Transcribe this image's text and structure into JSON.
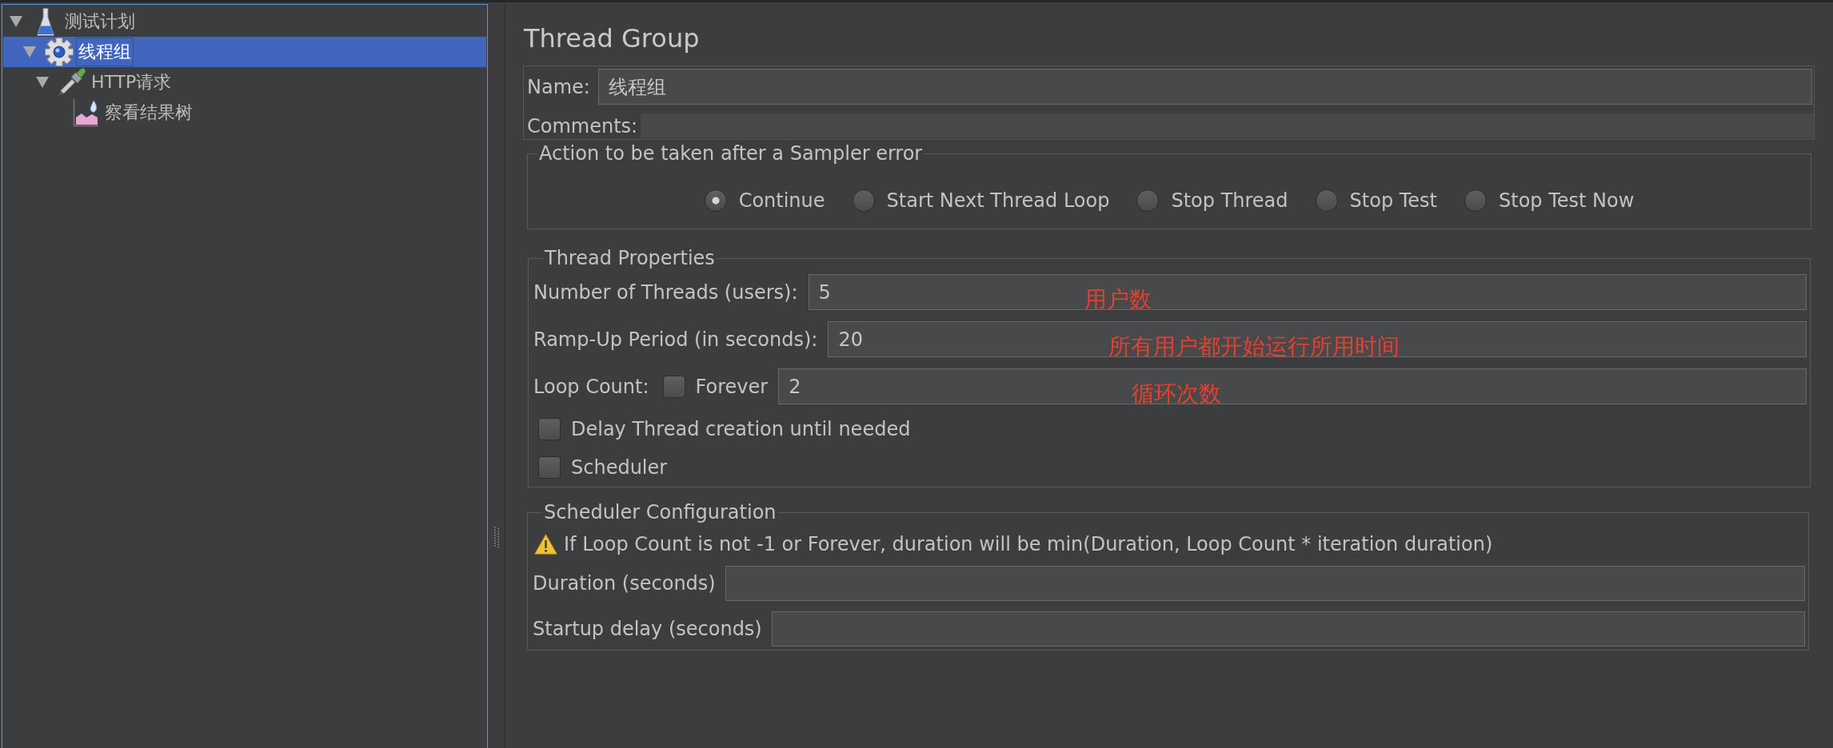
{
  "tree": [
    {
      "label": "测试计划",
      "kind": "test-plan",
      "expanded": true,
      "selected": false,
      "children": [
        {
          "label": "线程组",
          "kind": "thread-group",
          "expanded": true,
          "selected": true,
          "children": [
            {
              "label": "HTTP请求",
              "kind": "sampler",
              "expanded": true,
              "selected": false,
              "children": [
                {
                  "label": "察看结果树",
                  "kind": "listener",
                  "selected": false
                }
              ]
            }
          ]
        }
      ]
    }
  ],
  "editor": {
    "title": "Thread Group",
    "name_field": {
      "label": "Name:",
      "value": "线程组"
    },
    "comments_field": {
      "label": "Comments:"
    },
    "sampler_error": {
      "title": "Action to be taken after a Sampler error",
      "options": [
        {
          "label": "Continue",
          "selected": true
        },
        {
          "label": "Start Next Thread Loop",
          "selected": false
        },
        {
          "label": "Stop Thread",
          "selected": false
        },
        {
          "label": "Stop Test",
          "selected": false
        },
        {
          "label": "Stop Test Now",
          "selected": false
        }
      ]
    },
    "thread_properties": {
      "title": "Thread Properties",
      "rows": [
        {
          "kind": "field",
          "label": "Number of Threads (users):",
          "value": "5",
          "annotation": "用户数"
        },
        {
          "kind": "field",
          "label": "Ramp-Up Period (in seconds):",
          "value": "20",
          "annotation": "所有用户都开始运行所用时间"
        },
        {
          "kind": "loop",
          "label": "Loop Count:",
          "option": {
            "label": "Forever",
            "checked": false
          },
          "value": "2",
          "annotation": "循环次数"
        },
        {
          "kind": "checkbox",
          "label": "Delay Thread creation until needed",
          "checked": false
        },
        {
          "kind": "checkbox",
          "label": "Scheduler",
          "checked": false
        }
      ]
    },
    "scheduler": {
      "title": "Scheduler Configuration",
      "warning": "If Loop Count is not -1 or Forever, duration will be min(Duration, Loop Count * iteration duration)",
      "fields": [
        {
          "label": "Duration (seconds)"
        },
        {
          "label": "Startup delay (seconds)"
        }
      ]
    }
  }
}
